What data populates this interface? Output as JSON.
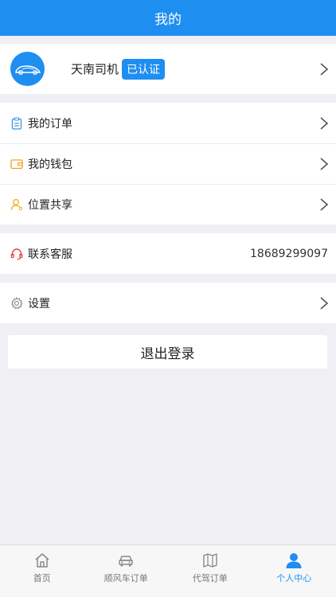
{
  "header": {
    "title": "我的"
  },
  "profile": {
    "name": "天南司机",
    "badge": "已认证"
  },
  "menu": [
    {
      "label": "我的订单",
      "icon": "clipboard-icon"
    },
    {
      "label": "我的钱包",
      "icon": "wallet-icon"
    },
    {
      "label": "位置共享",
      "icon": "user-location-icon"
    }
  ],
  "service": {
    "label": "联系客服",
    "phone": "18689299097",
    "icon": "headset-icon"
  },
  "settings": {
    "label": "设置",
    "icon": "gear-icon"
  },
  "logout": {
    "label": "退出登录"
  },
  "tabs": [
    {
      "label": "首页",
      "icon": "home-icon",
      "active": false
    },
    {
      "label": "顺风车订单",
      "icon": "car-icon",
      "active": false
    },
    {
      "label": "代驾订单",
      "icon": "map-icon",
      "active": false
    },
    {
      "label": "个人中心",
      "icon": "person-icon",
      "active": true
    }
  ],
  "colors": {
    "accent": "#1f8ef1",
    "background": "#efeff4"
  }
}
